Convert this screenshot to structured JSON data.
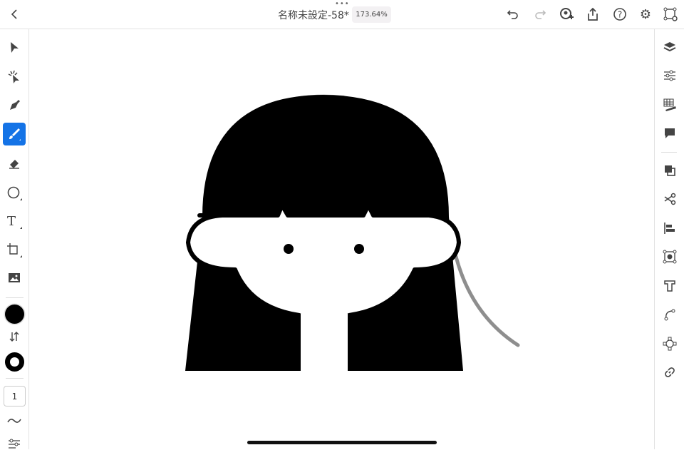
{
  "document": {
    "title": "名称未設定-58*",
    "zoom": "173.64%"
  },
  "toolbar_left": {
    "stroke_width": "1"
  },
  "colors": {
    "accent": "#1473e6",
    "fill": "#000000",
    "stroke_preview": "#8e8e8e"
  }
}
